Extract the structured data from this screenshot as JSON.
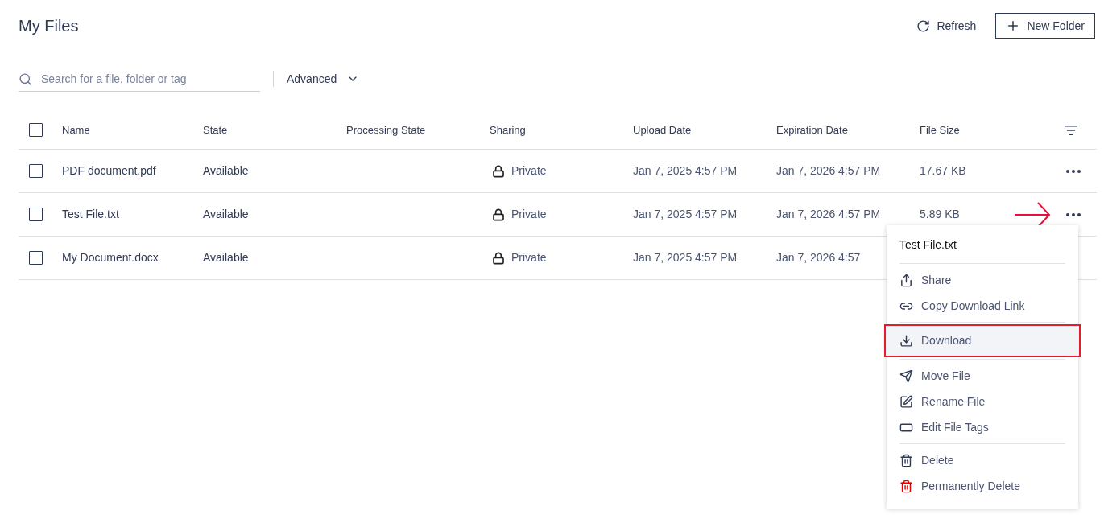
{
  "title": "My Files",
  "header_actions": {
    "refresh": "Refresh",
    "new_folder": "New Folder"
  },
  "search": {
    "placeholder": "Search for a file, folder or tag"
  },
  "advanced": "Advanced",
  "table": {
    "select_all": {
      "checked": false
    },
    "columns": [
      "Name",
      "State",
      "Processing State",
      "Sharing",
      "Upload Date",
      "Expiration Date",
      "File Size"
    ],
    "rows": [
      {
        "checked": false,
        "name": "PDF document.pdf",
        "state": "Available",
        "sharing": "Private",
        "upload_date": "Jan 7, 2025 4:57 PM",
        "expiration_date": "Jan 7, 2026 4:57 PM",
        "file_size": "17.67 KB",
        "menu_visible": true
      },
      {
        "checked": false,
        "name": "Test File.txt",
        "state": "Available",
        "sharing": "Private",
        "upload_date": "Jan 7, 2025 4:57 PM",
        "expiration_date": "Jan 7, 2026 4:57 PM",
        "file_size": "5.89 KB",
        "menu_visible": true,
        "pointed": true
      },
      {
        "checked": false,
        "name": "My Document.docx",
        "state": "Available",
        "sharing": "Private",
        "upload_date": "Jan 7, 2025 4:57 PM",
        "expiration_date": "Jan 7, 2026 4:57",
        "menu_visible": false
      }
    ]
  },
  "context_menu": {
    "title": "Test File.txt",
    "groups": [
      [
        {
          "label": "Share",
          "kind": "normal",
          "highlighted": false
        },
        {
          "label": "Copy Download Link",
          "kind": "normal",
          "highlighted": false
        }
      ],
      [
        {
          "label": "Download",
          "kind": "normal",
          "highlighted": true
        }
      ],
      [
        {
          "label": "Move File",
          "kind": "normal",
          "highlighted": false
        },
        {
          "label": "Rename File",
          "kind": "normal",
          "highlighted": false
        },
        {
          "label": "Edit File Tags",
          "kind": "normal",
          "highlighted": false
        }
      ],
      [
        {
          "label": "Delete",
          "kind": "normal",
          "highlighted": false
        },
        {
          "label": "Permanently Delete",
          "kind": "danger",
          "highlighted": false
        }
      ]
    ]
  }
}
